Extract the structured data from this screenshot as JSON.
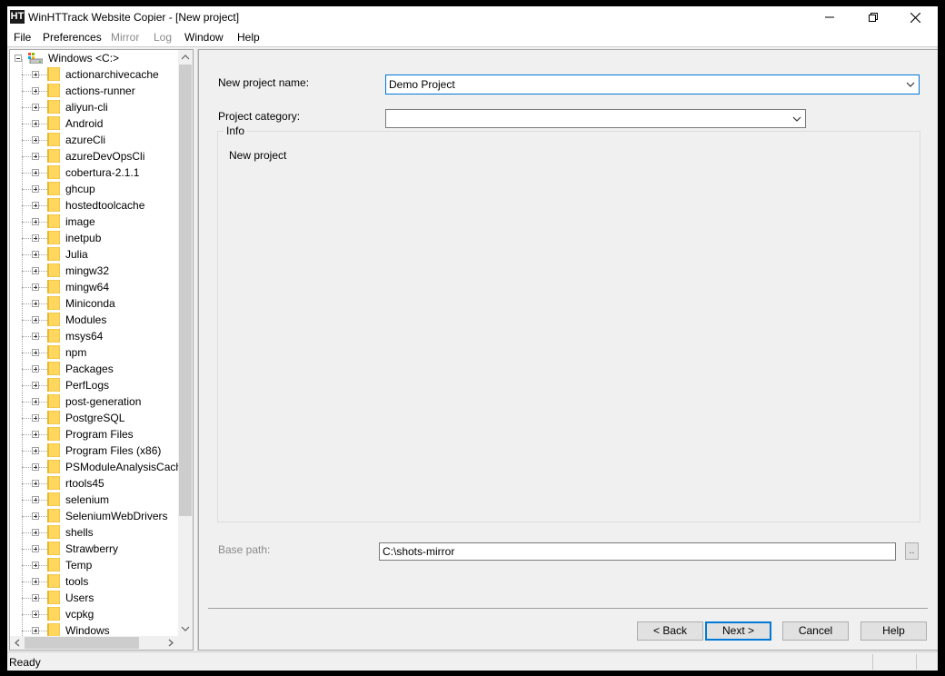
{
  "window": {
    "app_icon_text": "HT",
    "title": "WinHTTrack Website Copier - [New project]"
  },
  "menu": {
    "items": [
      {
        "label": "File",
        "enabled": true
      },
      {
        "label": "Preferences",
        "enabled": true
      },
      {
        "label": "Mirror",
        "enabled": false
      },
      {
        "label": "Log",
        "enabled": false
      },
      {
        "label": "Window",
        "enabled": true
      },
      {
        "label": "Help",
        "enabled": true
      }
    ]
  },
  "tree": {
    "root_label": "Windows <C:>",
    "folders": [
      "actionarchivecache",
      "actions-runner",
      "aliyun-cli",
      "Android",
      "azureCli",
      "azureDevOpsCli",
      "cobertura-2.1.1",
      "ghcup",
      "hostedtoolcache",
      "image",
      "inetpub",
      "Julia",
      "mingw32",
      "mingw64",
      "Miniconda",
      "Modules",
      "msys64",
      "npm",
      "Packages",
      "PerfLogs",
      "post-generation",
      "PostgreSQL",
      "Program Files",
      "Program Files (x86)",
      "PSModuleAnalysisCache",
      "rtools45",
      "selenium",
      "SeleniumWebDrivers",
      "shells",
      "Strawberry",
      "Temp",
      "tools",
      "Users",
      "vcpkg",
      "Windows"
    ]
  },
  "form": {
    "project_name_label": "New project name:",
    "project_name_value": "Demo Project",
    "category_label": "Project category:",
    "category_value": "",
    "info_title": "Info",
    "info_text": "New project",
    "base_path_label": "Base path:",
    "base_path_value": "C:\\shots-mirror",
    "browse_label": ".."
  },
  "buttons": {
    "back": "< Back",
    "next": "Next >",
    "cancel": "Cancel",
    "help": "Help"
  },
  "status": {
    "text": "Ready"
  },
  "colors": {
    "focus_accent": "#0078d7",
    "folder_yellow": "#ffd75e",
    "disabled_text": "#8a8a8a"
  }
}
